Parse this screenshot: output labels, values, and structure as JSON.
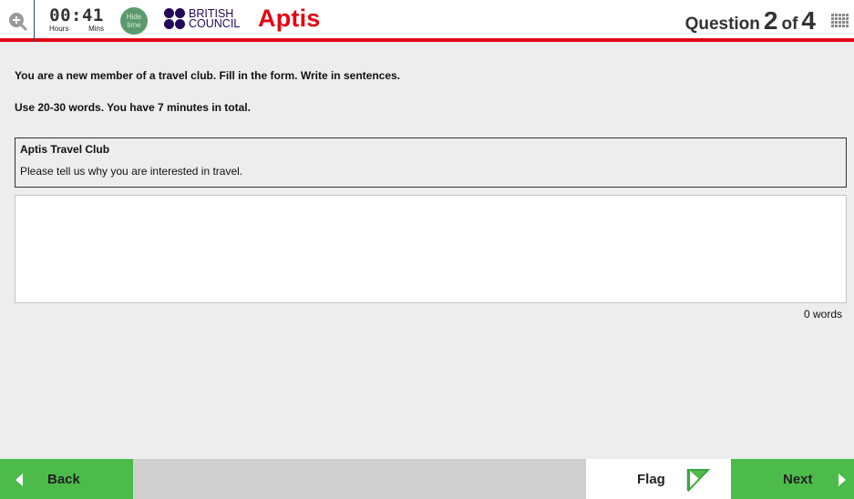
{
  "header": {
    "timer": {
      "time": "00:41",
      "hours_label": "Hours",
      "mins_label": "Mins"
    },
    "hide_time_label": "Hide time",
    "brand": {
      "line1": "BRITISH",
      "line2": "COUNCIL"
    },
    "product": "Aptis",
    "question": {
      "prefix": "Question",
      "current": "2",
      "of": "of",
      "total": "4"
    }
  },
  "task": {
    "instruction1": "You are a new member of a travel club. Fill in the form. Write in sentences.",
    "instruction2": "Use 20-30 words. You have 7 minutes in total.",
    "form_title": "Aptis Travel Club",
    "form_prompt": "Please tell us why you are interested in travel.",
    "answer_value": "",
    "word_count": "0 words"
  },
  "footer": {
    "back_label": "Back",
    "flag_label": "Flag",
    "next_label": "Next"
  },
  "colors": {
    "accent_red": "#e30613",
    "nav_green": "#4cbb4a",
    "brand_navy": "#23085a"
  },
  "icons": [
    "zoom-in-icon",
    "question-grid-icon",
    "back-arrow-icon",
    "flag-icon",
    "next-arrow-icon"
  ]
}
